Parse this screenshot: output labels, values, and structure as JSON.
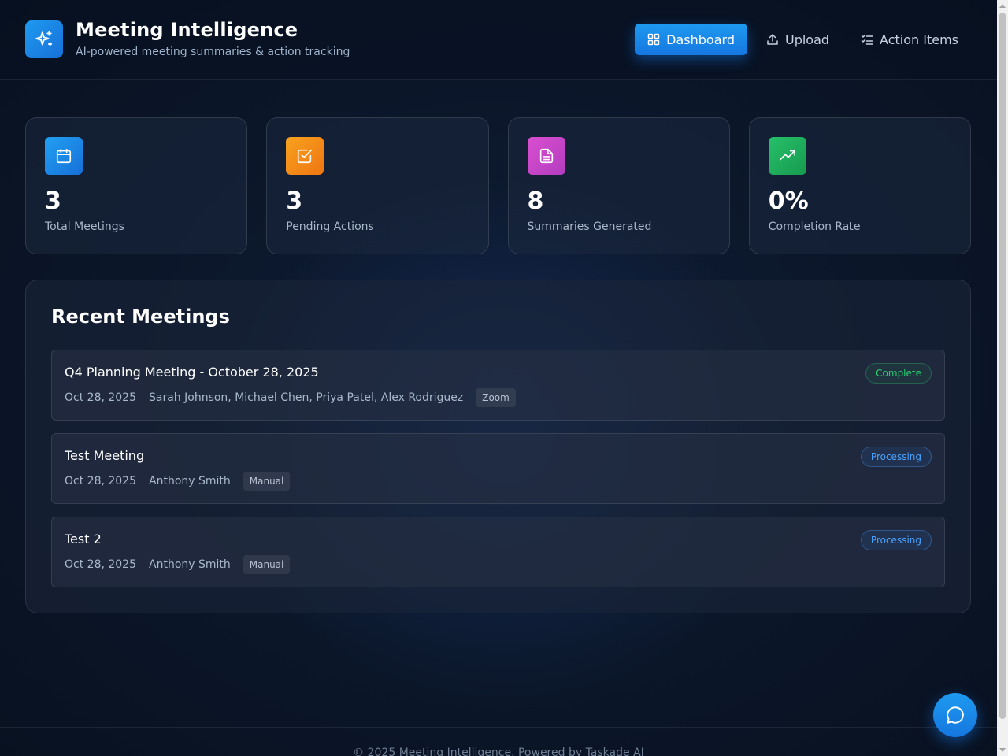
{
  "header": {
    "title": "Meeting Intelligence",
    "subtitle": "AI-powered meeting summaries & action tracking",
    "logo_icon": "sparkles-icon",
    "nav": [
      {
        "label": "Dashboard",
        "icon": "grid-icon",
        "active": true
      },
      {
        "label": "Upload",
        "icon": "upload-icon",
        "active": false
      },
      {
        "label": "Action Items",
        "icon": "checklist-icon",
        "active": false
      }
    ]
  },
  "stats": [
    {
      "value": "3",
      "label": "Total Meetings",
      "icon": "calendar-icon",
      "color": "#1e88e5"
    },
    {
      "value": "3",
      "label": "Pending Actions",
      "icon": "checkbox-icon",
      "color": "#f28c1a"
    },
    {
      "value": "8",
      "label": "Summaries Generated",
      "icon": "document-icon",
      "color": "#c34ac7"
    },
    {
      "value": "0%",
      "label": "Completion Rate",
      "icon": "trending-up-icon",
      "color": "#1fae5b"
    }
  ],
  "recent": {
    "title": "Recent Meetings",
    "meetings": [
      {
        "title": "Q4 Planning Meeting - October 28, 2025",
        "date": "Oct 28, 2025",
        "participants": "Sarah Johnson, Michael Chen, Priya Patel, Alex Rodriguez",
        "source": "Zoom",
        "status": "Complete"
      },
      {
        "title": "Test Meeting",
        "date": "Oct 28, 2025",
        "participants": "Anthony Smith",
        "source": "Manual",
        "status": "Processing"
      },
      {
        "title": "Test 2",
        "date": "Oct 28, 2025",
        "participants": "Anthony Smith",
        "source": "Manual",
        "status": "Processing"
      }
    ]
  },
  "footer": {
    "text": "© 2025 Meeting Intelligence. Powered by Taskade AI"
  },
  "chat": {
    "icon": "chat-bubble-icon"
  },
  "colors": {
    "accent": "#1e9af0",
    "complete": "#2ecc71",
    "processing": "#4ba3ff"
  }
}
